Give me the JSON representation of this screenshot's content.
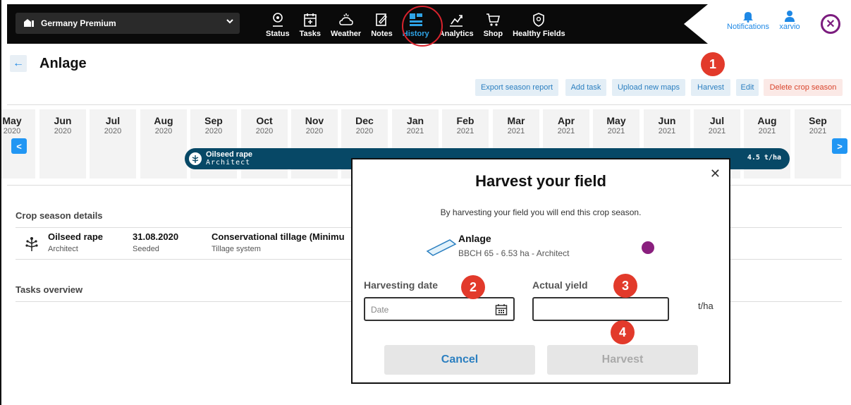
{
  "topbar": {
    "farm_name": "Germany Premium",
    "nav": [
      {
        "label": "Status",
        "icon": "status-pin-icon"
      },
      {
        "label": "Tasks",
        "icon": "tasks-calendar-icon"
      },
      {
        "label": "Weather",
        "icon": "weather-icon"
      },
      {
        "label": "Notes",
        "icon": "notes-icon"
      },
      {
        "label": "History",
        "icon": "history-icon",
        "active": true
      },
      {
        "label": "Analytics",
        "icon": "analytics-icon"
      },
      {
        "label": "Shop",
        "icon": "shop-cart-icon"
      },
      {
        "label": "Healthy Fields",
        "icon": "shield-icon"
      }
    ],
    "notifications_label": "Notifications",
    "user_label": "xarvio",
    "accent_color": "#2fa4e7"
  },
  "header": {
    "title": "Anlage",
    "actions": {
      "export": "Export season report",
      "add_task": "Add task",
      "upload_maps": "Upload new maps",
      "harvest": "Harvest",
      "edit": "Edit",
      "delete": "Delete crop season"
    }
  },
  "steps": [
    "1",
    "2",
    "3",
    "4"
  ],
  "timeline": {
    "months": [
      {
        "m": "May",
        "y": "2020"
      },
      {
        "m": "Jun",
        "y": "2020"
      },
      {
        "m": "Jul",
        "y": "2020"
      },
      {
        "m": "Aug",
        "y": "2020"
      },
      {
        "m": "Sep",
        "y": "2020"
      },
      {
        "m": "Oct",
        "y": "2020"
      },
      {
        "m": "Nov",
        "y": "2020"
      },
      {
        "m": "Dec",
        "y": "2020"
      },
      {
        "m": "Jan",
        "y": "2021"
      },
      {
        "m": "Feb",
        "y": "2021"
      },
      {
        "m": "Mar",
        "y": "2021"
      },
      {
        "m": "Apr",
        "y": "2021"
      },
      {
        "m": "May",
        "y": "2021"
      },
      {
        "m": "Jun",
        "y": "2021"
      },
      {
        "m": "Jul",
        "y": "2021"
      },
      {
        "m": "Aug",
        "y": "2021"
      },
      {
        "m": "Sep",
        "y": "2021"
      }
    ],
    "season": {
      "crop": "Oilseed rape",
      "variety": "Architect",
      "yield": "4.5 t/ha"
    }
  },
  "details": {
    "section_title": "Crop season details",
    "crop": "Oilseed rape",
    "variety": "Architect",
    "date": "31.08.2020",
    "date_label": "Seeded",
    "tillage": "Conservational tillage (Minimu",
    "tillage_label": "Tillage system",
    "tasks_title": "Tasks overview"
  },
  "modal": {
    "title": "Harvest your field",
    "description": "By harvesting your field you will end this crop season.",
    "field_name": "Anlage",
    "field_info": "BBCH 65 - 6.53 ha - Architect",
    "field_color": "#8a1f7e",
    "date_label": "Harvesting date",
    "date_placeholder": "Date",
    "yield_label": "Actual yield",
    "yield_value": "",
    "unit": "t/ha",
    "cancel": "Cancel",
    "harvest": "Harvest"
  }
}
